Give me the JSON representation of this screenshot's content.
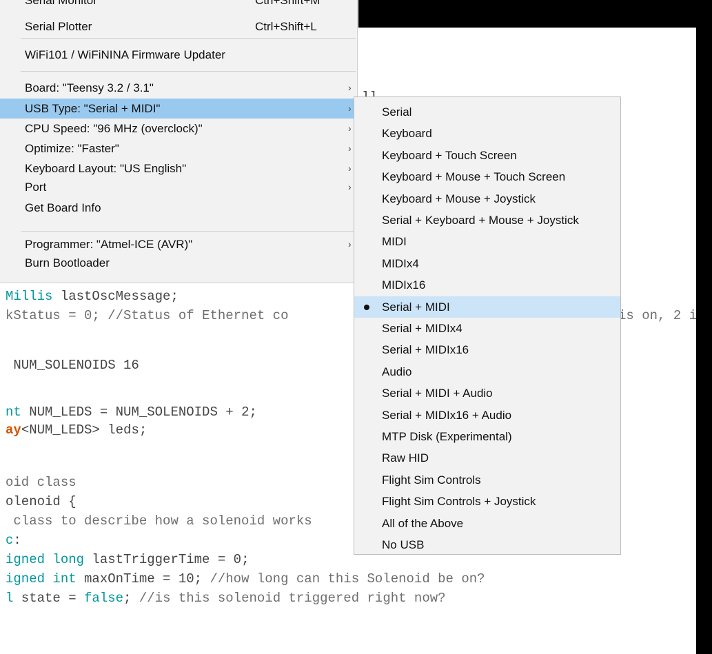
{
  "menu": {
    "top_partial": {
      "label": "Serial Monitor",
      "shortcut": "Ctrl+Shift+M"
    },
    "items": [
      {
        "label": "Serial Plotter",
        "shortcut": "Ctrl+Shift+L"
      },
      {
        "label": "WiFi101 / WiFiNINA Firmware Updater"
      },
      {
        "label": "Board: \"Teensy 3.2 / 3.1\"",
        "arrow": "›"
      },
      {
        "label": "USB Type: \"Serial + MIDI\"",
        "arrow": "›"
      },
      {
        "label": "CPU Speed: \"96 MHz (overclock)\"",
        "arrow": "›"
      },
      {
        "label": "Optimize: \"Faster\"",
        "arrow": "›"
      },
      {
        "label": "Keyboard Layout: \"US English\"",
        "arrow": "›"
      },
      {
        "label": "Port",
        "arrow": "›"
      },
      {
        "label": "Get Board Info"
      },
      {
        "label": "Programmer: \"Atmel-ICE (AVR)\"",
        "arrow": "›"
      },
      {
        "label": "Burn Bootloader"
      }
    ]
  },
  "submenu": {
    "items": [
      "Serial",
      "Keyboard",
      "Keyboard + Touch Screen",
      "Keyboard + Mouse + Touch Screen",
      "Keyboard + Mouse + Joystick",
      "Serial + Keyboard + Mouse + Joystick",
      "MIDI",
      "MIDIx4",
      "MIDIx16",
      "Serial + MIDI",
      "Serial + MIDIx4",
      "Serial + MIDIx16",
      "Audio",
      "Serial + MIDI + Audio",
      "Serial + MIDIx16 + Audio",
      "MTP Disk (Experimental)",
      "Raw HID",
      "Flight Sim Controls",
      "Flight Sim Controls + Joystick",
      "All of the Above",
      "No USB"
    ],
    "selected": "Serial + MIDI"
  },
  "code": {
    "fragment_top": "ll",
    "lines": [
      {
        "parts": [
          {
            "t": "Millis",
            "c": "kw"
          },
          {
            "t": " lastOscMessage;"
          }
        ]
      },
      {
        "parts": [
          {
            "t": "kStatus = 0; //Status of Ethernet co",
            "c": "cm"
          }
        ]
      },
      {
        "parts": [
          {
            "t": "is on, 2 i",
            "c": "cm"
          }
        ]
      },
      {
        "parts": [
          {
            "t": " NUM_SOLENOIDS 16"
          }
        ]
      },
      {
        "parts": [
          {
            "t": "nt",
            "c": "kw"
          },
          {
            "t": " NUM_LEDS = NUM_SOLENOIDS + 2;"
          }
        ]
      },
      {
        "parts": [
          {
            "t": "ay",
            "c": "kw2"
          },
          {
            "t": "<NUM_LEDS> leds;"
          }
        ]
      },
      {
        "parts": [
          {
            "t": "oid class",
            "c": "cm"
          }
        ]
      },
      {
        "parts": [
          {
            "t": "olenoid {"
          }
        ]
      },
      {
        "parts": [
          {
            "t": " class to describe how a solenoid works",
            "c": "cm"
          }
        ]
      },
      {
        "parts": [
          {
            "t": "c",
            "c": "kw"
          },
          {
            "t": ":"
          }
        ]
      },
      {
        "parts": [
          {
            "t": "igned long",
            "c": "kw"
          },
          {
            "t": " lastTriggerTime = 0;"
          }
        ]
      },
      {
        "parts": [
          {
            "t": "igned int",
            "c": "kw"
          },
          {
            "t": " maxOnTime = 10; "
          },
          {
            "t": "//how long can this Solenoid be on?",
            "c": "cm"
          }
        ]
      },
      {
        "parts": [
          {
            "t": "l",
            "c": "kw"
          },
          {
            "t": " state = "
          },
          {
            "t": "false",
            "c": "lit"
          },
          {
            "t": "; "
          },
          {
            "t": "//is this solenoid triggered right now?",
            "c": "cm"
          }
        ]
      }
    ]
  }
}
